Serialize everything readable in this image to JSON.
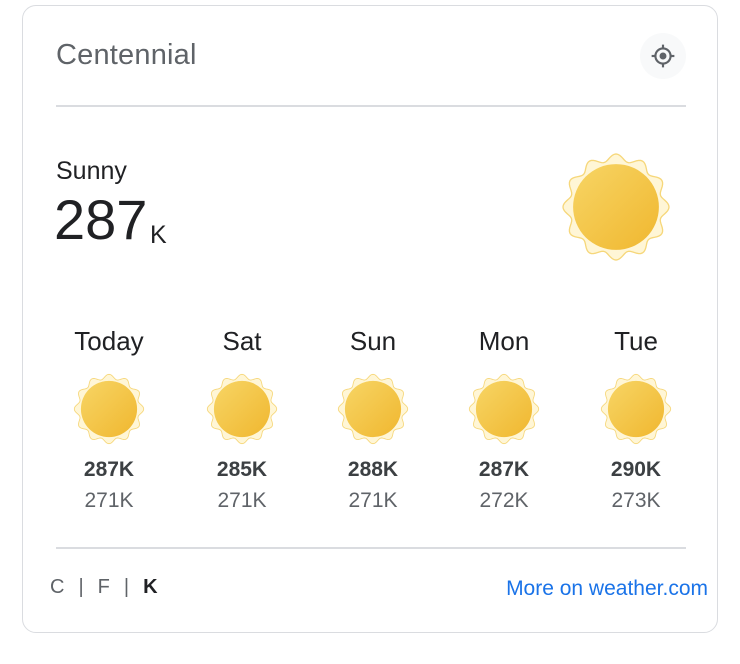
{
  "header": {
    "city": "Centennial",
    "locate_icon": "my-location-icon"
  },
  "current": {
    "condition": "Sunny",
    "temperature": "287",
    "unit": "K",
    "icon": "sun-icon"
  },
  "forecast": [
    {
      "day": "Today",
      "high": "287K",
      "low": "271K",
      "icon": "sun-icon"
    },
    {
      "day": "Sat",
      "high": "285K",
      "low": "271K",
      "icon": "sun-icon"
    },
    {
      "day": "Sun",
      "high": "288K",
      "low": "271K",
      "icon": "sun-icon"
    },
    {
      "day": "Mon",
      "high": "287K",
      "low": "272K",
      "icon": "sun-icon"
    },
    {
      "day": "Tue",
      "high": "290K",
      "low": "273K",
      "icon": "sun-icon"
    }
  ],
  "units": {
    "c": "C",
    "f": "F",
    "k": "K",
    "separator": "|",
    "selected": "K"
  },
  "footer": {
    "more_link": "More on weather.com"
  },
  "colors": {
    "sun_fill": "#f4c542",
    "sun_edge": "#f0b429",
    "link": "#1a73e8"
  }
}
